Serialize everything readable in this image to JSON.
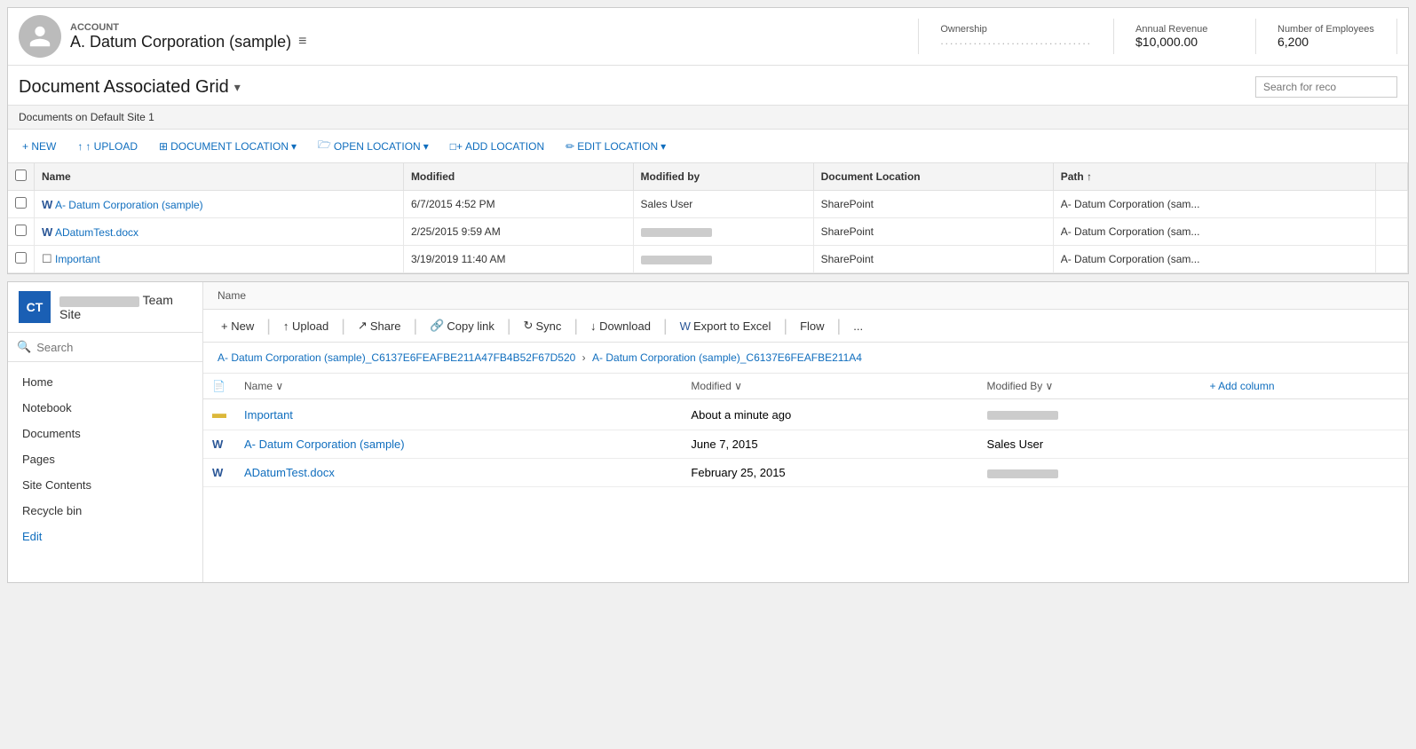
{
  "crm": {
    "account": {
      "label": "ACCOUNT",
      "name": "A. Datum Corporation (sample)",
      "fields": {
        "ownership": {
          "label": "Ownership",
          "value": "................................"
        },
        "annual_revenue": {
          "label": "Annual Revenue",
          "value": "$10,000.00"
        },
        "num_employees": {
          "label": "Number of Employees",
          "value": "6,200"
        }
      }
    },
    "grid": {
      "title": "Document Associated Grid",
      "dropdown_char": "▾",
      "search_placeholder": "Search for reco",
      "site_label": "Documents on Default Site 1",
      "toolbar": {
        "new_btn": "+ NEW",
        "upload_btn": "↑ UPLOAD",
        "document_location_btn": "DOCUMENT LOCATION",
        "open_location_btn": "OPEN LOCATION",
        "add_location_btn": "ADD LOCATION",
        "edit_location_btn": "EDIT LOCATION"
      },
      "columns": [
        "Name",
        "Modified",
        "Modified by",
        "Document Location",
        "Path ↑"
      ],
      "rows": [
        {
          "icon": "word",
          "name": "A- Datum Corporation (sample)",
          "modified": "6/7/2015 4:52 PM",
          "modified_by": "Sales User",
          "doc_location": "SharePoint",
          "path": "A- Datum Corporation (sam..."
        },
        {
          "icon": "word",
          "name": "ADatumTest.docx",
          "modified": "2/25/2015 9:59 AM",
          "modified_by_blur": true,
          "doc_location": "SharePoint",
          "path": "A- Datum Corporation (sam..."
        },
        {
          "icon": "file",
          "name": "Important",
          "modified": "3/19/2019 11:40 AM",
          "modified_by_blur": true,
          "doc_location": "SharePoint",
          "path": "A- Datum Corporation (sam..."
        }
      ]
    }
  },
  "sharepoint": {
    "logo_initials": "CT",
    "site_name_blur": true,
    "site_name_suffix": "Team Site",
    "top_bar_name": "Name",
    "toolbar": {
      "new_btn": "+ New",
      "upload_btn": "↑ Upload",
      "share_btn": "Share",
      "copy_link_btn": "Copy link",
      "sync_btn": "Sync",
      "download_btn": "↓ Download",
      "export_btn": "Export to Excel",
      "flow_btn": "Flow",
      "more_btn": "..."
    },
    "breadcrumb": {
      "part1": "A- Datum Corporation (sample)_C6137E6FEAFBE211A47FB4B52F67D520",
      "sep": ">",
      "part2": "A- Datum Corporation (sample)_C6137E6FEAFBE211A4"
    },
    "nav": {
      "search_placeholder": "Search",
      "items": [
        "Home",
        "Notebook",
        "Documents",
        "Pages",
        "Site Contents",
        "Recycle bin",
        "Edit"
      ]
    },
    "table": {
      "columns": [
        "Name",
        "Modified",
        "Modified By",
        "+ Add column"
      ],
      "rows": [
        {
          "icon": "folder",
          "name": "Important",
          "modified": "About a minute ago",
          "modified_by_blur": true
        },
        {
          "icon": "word",
          "name": "A- Datum Corporation (sample)",
          "modified": "June 7, 2015",
          "modified_by": "Sales User"
        },
        {
          "icon": "word",
          "name": "ADatumTest.docx",
          "modified": "February 25, 2015",
          "modified_by_blur": true
        }
      ]
    }
  }
}
